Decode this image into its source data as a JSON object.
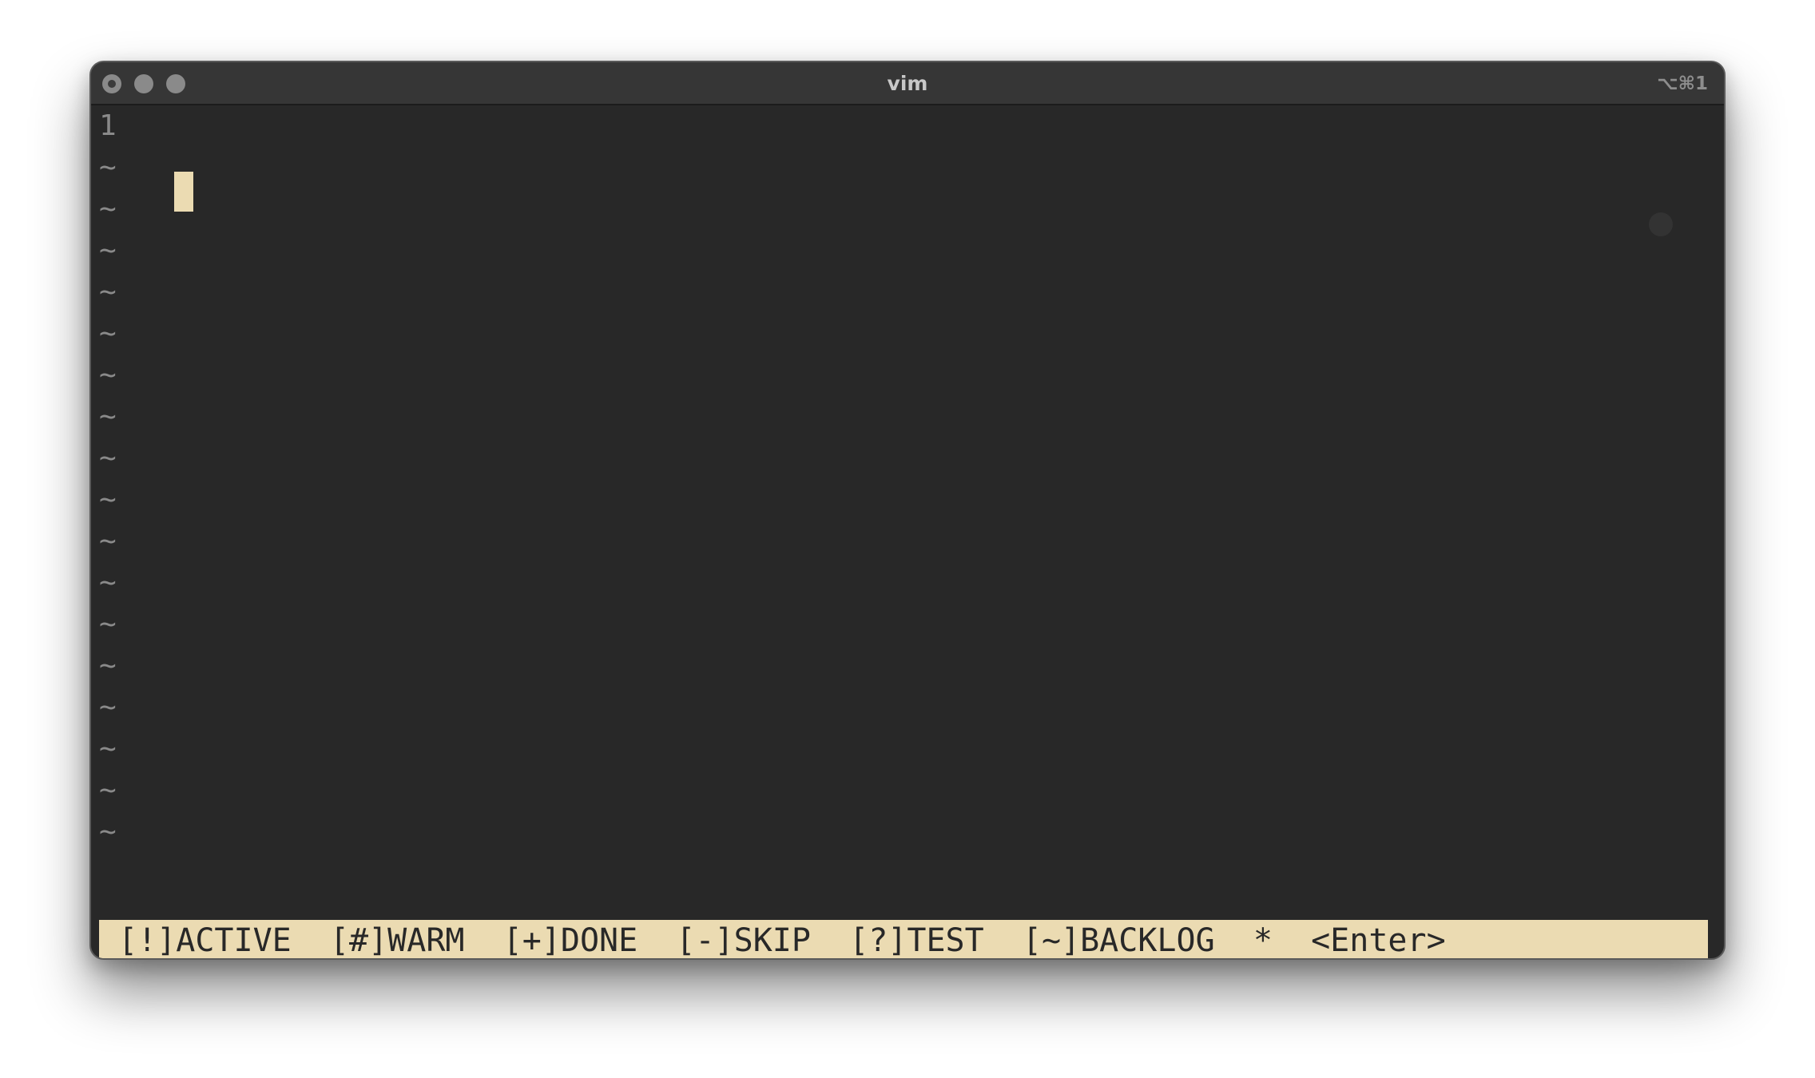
{
  "window": {
    "title": "vim",
    "shortcut": "⌥⌘1"
  },
  "editor": {
    "line_number": "1",
    "tilde": "~",
    "tilde_count": 17
  },
  "statusbar": {
    "text": "[!]ACTIVE  [#]WARM  [+]DONE  [-]SKIP  [?]TEST  [~]BACKLOG  *  <Enter>"
  },
  "colors": {
    "background": "#282828",
    "titlebar": "#363636",
    "cursor": "#ebdbb2",
    "statusbar_bg": "#ebdbb2",
    "statusbar_fg": "#282828",
    "tilde": "#8a8a8a"
  }
}
